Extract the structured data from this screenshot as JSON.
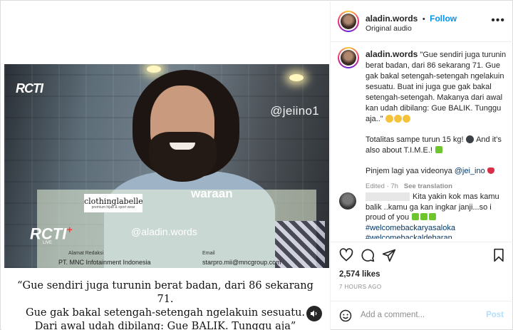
{
  "video": {
    "rcti_logo": "RCTI",
    "watermark_top": "@jeiino1",
    "brand_name": "clothinglabelle",
    "brand_sub": "premium hijab & sport wear",
    "sponsor": "waraan",
    "rcti_plus": "RCTI",
    "rcti_plus_sign": "+",
    "live_tag": "LIVE",
    "watermark_handle": "@aladin.words",
    "address_title": "Alamat Redaksi",
    "address_line": "PT. MNC Infotainment Indonesia",
    "email_title": "Email",
    "email_line": "starpro.mii@mncgroup.com"
  },
  "subtitle": {
    "line1": "“Gue sendiri juga turunin berat badan, dari 86 sekarang 71.",
    "line2": "Gue gak bakal setengah-setengah ngelakuin sesuatu.",
    "line3": "Dari awal udah dibilang: Gue BALIK. Tunggu aja”"
  },
  "header": {
    "username": "aladin.words",
    "separator": "•",
    "follow_label": "Follow",
    "audio_label": "Original audio",
    "more_label": "•••"
  },
  "caption": {
    "username": "aladin.words",
    "para1": "\"Gue sendiri juga turunin berat badan, dari 86 sekarang 71. Gue gak bakal setengah-setengah ngelakuin sesuatu. Buat ini juga gue gak bakal setengah-setengah. Makanya dari awal kan udah dibilang: Gue BALIK. Tunggu aja..\"",
    "para2": "Totalitas sampe turun 15 kg!",
    "para2b": "And it's also about T.I.M.E.!",
    "para3": "Pinjem lagi yaa videonya",
    "para3_tag": "@jei_ino",
    "edited": "Edited · 7h",
    "see_translation": "See translation"
  },
  "comment": {
    "text1": "Kita yakin kok mas kamu balik ..kamu ga kan ingkar janji...so i proud of you",
    "tag1": "#welcomebackaryasaloka",
    "tag2": "#welcomebackaldebaran"
  },
  "post": {
    "likes": "2,574 likes",
    "time": "7 HOURS AGO"
  },
  "add_comment": {
    "placeholder": "Add a comment...",
    "post_label": "Post"
  }
}
